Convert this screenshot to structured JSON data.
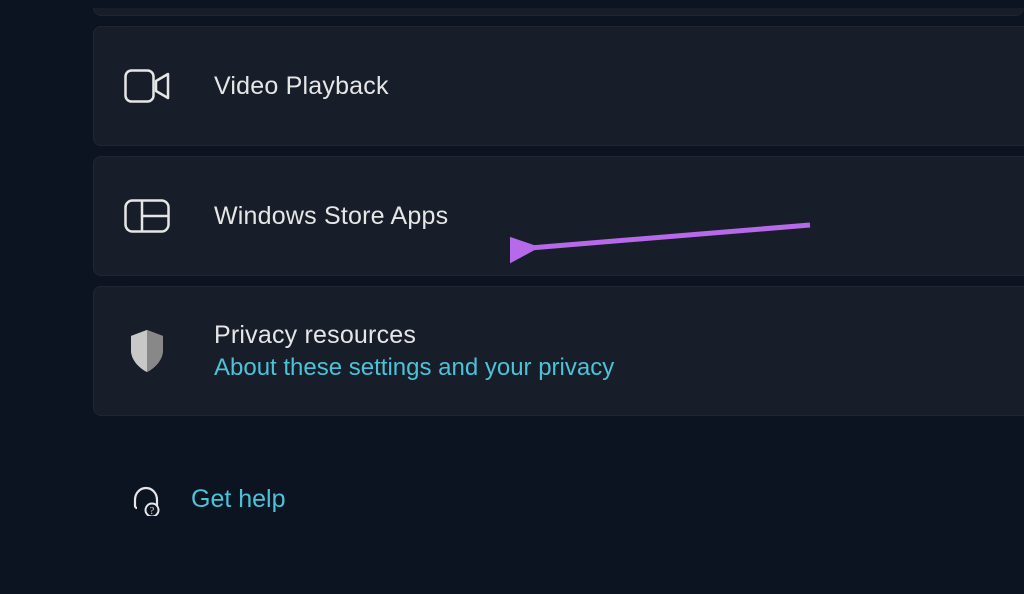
{
  "cards": {
    "video_playback": {
      "title": "Video Playback"
    },
    "windows_store_apps": {
      "title": "Windows Store Apps"
    },
    "privacy_resources": {
      "title": "Privacy resources",
      "link": "About these settings and your privacy"
    }
  },
  "help": {
    "link": "Get help"
  },
  "annotation": {
    "color": "#b669e8"
  }
}
